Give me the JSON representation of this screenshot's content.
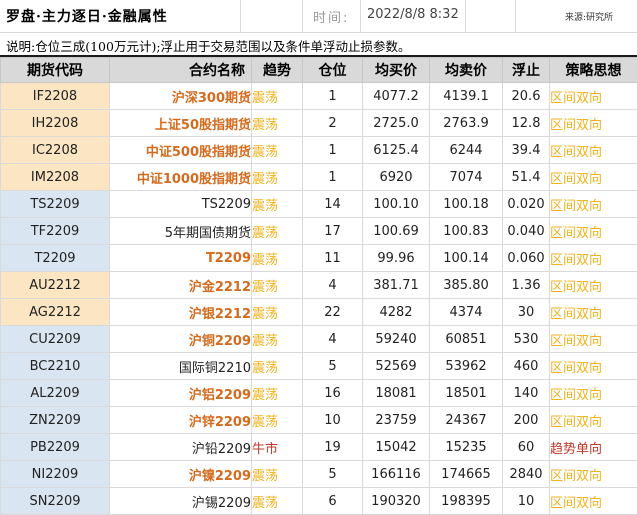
{
  "header": {
    "title": "罗盘·主力逐日·金融属性",
    "time_label": "时间:",
    "time_value": "2022/8/8 8:32",
    "source": "来源:研究所"
  },
  "note": "说明:仓位三成(100万元计);浮止用于交易范围以及条件单浮动止损参数。",
  "columns": {
    "code": "期货代码",
    "name": "合约名称",
    "trend": "趋势",
    "position": "仓位",
    "avg_buy": "均买价",
    "avg_sell": "均卖价",
    "float_stop": "浮止",
    "strategy": "策略思想"
  },
  "rows": [
    {
      "code": "IF2208",
      "name": "沪深300期货",
      "trend": "震荡",
      "position": "1",
      "avg_buy": "4077.2",
      "avg_sell": "4139.1",
      "float_stop": "20.6",
      "strategy": "区间双向"
    },
    {
      "code": "IH2208",
      "name": "上证50股指期货",
      "trend": "震荡",
      "position": "2",
      "avg_buy": "2725.0",
      "avg_sell": "2763.9",
      "float_stop": "12.8",
      "strategy": "区间双向"
    },
    {
      "code": "IC2208",
      "name": "中证500股指期货",
      "trend": "震荡",
      "position": "1",
      "avg_buy": "6125.4",
      "avg_sell": "6244",
      "float_stop": "39.4",
      "strategy": "区间双向"
    },
    {
      "code": "IM2208",
      "name": "中证1000股指期货",
      "trend": "震荡",
      "position": "1",
      "avg_buy": "6920",
      "avg_sell": "7074",
      "float_stop": "51.4",
      "strategy": "区间双向"
    },
    {
      "code": "TS2209",
      "name": "TS2209",
      "trend": "震荡",
      "position": "14",
      "avg_buy": "100.10",
      "avg_sell": "100.18",
      "float_stop": "0.020",
      "strategy": "区间双向"
    },
    {
      "code": "TF2209",
      "name": "5年期国债期货",
      "trend": "震荡",
      "position": "17",
      "avg_buy": "100.69",
      "avg_sell": "100.83",
      "float_stop": "0.040",
      "strategy": "区间双向"
    },
    {
      "code": "T2209",
      "name": "T2209",
      "trend": "震荡",
      "position": "11",
      "avg_buy": "99.96",
      "avg_sell": "100.14",
      "float_stop": "0.060",
      "strategy": "区间双向"
    },
    {
      "code": "AU2212",
      "name": "沪金2212",
      "trend": "震荡",
      "position": "4",
      "avg_buy": "381.71",
      "avg_sell": "385.80",
      "float_stop": "1.36",
      "strategy": "区间双向"
    },
    {
      "code": "AG2212",
      "name": "沪银2212",
      "trend": "震荡",
      "position": "22",
      "avg_buy": "4282",
      "avg_sell": "4374",
      "float_stop": "30",
      "strategy": "区间双向"
    },
    {
      "code": "CU2209",
      "name": "沪铜2209",
      "trend": "震荡",
      "position": "4",
      "avg_buy": "59240",
      "avg_sell": "60851",
      "float_stop": "530",
      "strategy": "区间双向"
    },
    {
      "code": "BC2210",
      "name": "国际铜2210",
      "trend": "震荡",
      "position": "5",
      "avg_buy": "52569",
      "avg_sell": "53962",
      "float_stop": "460",
      "strategy": "区间双向"
    },
    {
      "code": "AL2209",
      "name": "沪铝2209",
      "trend": "震荡",
      "position": "16",
      "avg_buy": "18081",
      "avg_sell": "18501",
      "float_stop": "140",
      "strategy": "区间双向"
    },
    {
      "code": "ZN2209",
      "name": "沪锌2209",
      "trend": "震荡",
      "position": "10",
      "avg_buy": "23759",
      "avg_sell": "24367",
      "float_stop": "200",
      "strategy": "区间双向"
    },
    {
      "code": "PB2209",
      "name": "沪铅2209",
      "trend": "牛市",
      "position": "19",
      "avg_buy": "15042",
      "avg_sell": "15235",
      "float_stop": "60",
      "strategy": "趋势单向"
    },
    {
      "code": "NI2209",
      "name": "沪镍2209",
      "trend": "震荡",
      "position": "5",
      "avg_buy": "166116",
      "avg_sell": "174665",
      "float_stop": "2840",
      "strategy": "区间双向"
    },
    {
      "code": "SN2209",
      "name": "沪锡2209",
      "trend": "震荡",
      "position": "6",
      "avg_buy": "190320",
      "avg_sell": "198395",
      "float_stop": "10",
      "strategy": "区间双向"
    }
  ],
  "colors": {
    "highlight_name": "#d46b1e",
    "range_trend": "#f2b21b",
    "bull_trend": "#c0392b",
    "finance_bg": "#fbe5c2",
    "rate_bg": "#d9e6f2",
    "header_bg": "#d9d9d9"
  }
}
